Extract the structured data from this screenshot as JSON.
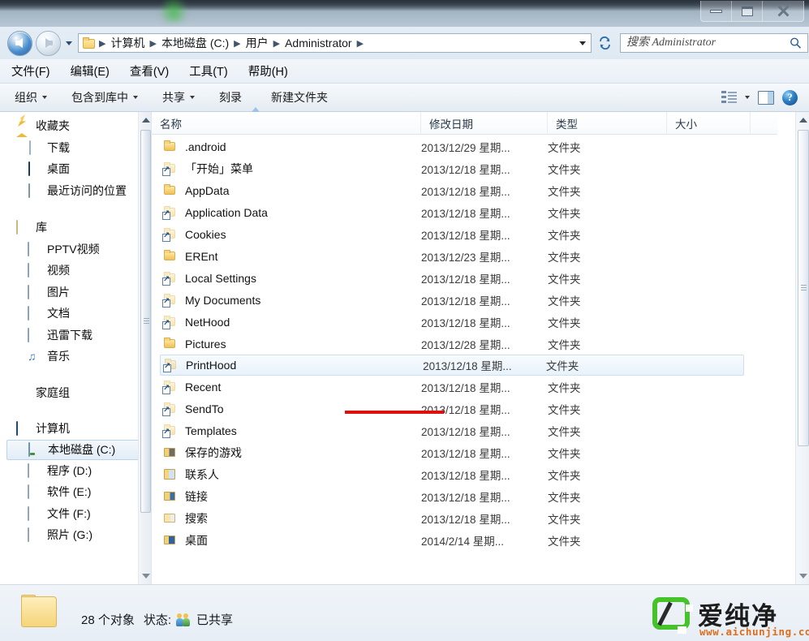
{
  "window": {
    "controls": {
      "minimize": "minimize-button",
      "maximize": "maximize-button",
      "close": "close-button"
    }
  },
  "address": {
    "back_label": "后退",
    "forward_label": "前进",
    "history_label": "最近浏览的位置",
    "refresh_label": "刷新",
    "breadcrumbs": [
      "计算机",
      "本地磁盘 (C:)",
      "用户",
      "Administrator"
    ],
    "separator": "▶"
  },
  "search": {
    "placeholder": "搜索 Administrator",
    "value": ""
  },
  "menu": {
    "items": [
      {
        "label": "文件(F)",
        "name": "menu-file"
      },
      {
        "label": "编辑(E)",
        "name": "menu-edit"
      },
      {
        "label": "查看(V)",
        "name": "menu-view"
      },
      {
        "label": "工具(T)",
        "name": "menu-tools"
      },
      {
        "label": "帮助(H)",
        "name": "menu-help"
      }
    ]
  },
  "toolbar": {
    "items": [
      {
        "label": "组织",
        "has_caret": true
      },
      {
        "label": "包含到库中",
        "has_caret": true
      },
      {
        "label": "共享",
        "has_caret": true
      },
      {
        "label": "刻录",
        "has_caret": false
      },
      {
        "label": "新建文件夹",
        "has_caret": false
      }
    ],
    "view_label": "更改您的视图",
    "preview_label": "显示预览窗格",
    "help_label": "获取帮助",
    "help_glyph": "?"
  },
  "sidebar": {
    "groups": [
      {
        "title": "收藏夹",
        "icon": "star-icon",
        "items": [
          {
            "label": "下载",
            "icon": "download-page-icon"
          },
          {
            "label": "桌面",
            "icon": "desktop-icon"
          },
          {
            "label": "最近访问的位置",
            "icon": "recent-places-icon"
          }
        ]
      },
      {
        "title": "库",
        "icon": "library-icon",
        "items": [
          {
            "label": "PPTV视频",
            "icon": "library-item-icon"
          },
          {
            "label": "视频",
            "icon": "library-item-icon"
          },
          {
            "label": "图片",
            "icon": "library-item-icon"
          },
          {
            "label": "文档",
            "icon": "library-item-icon"
          },
          {
            "label": "迅雷下载",
            "icon": "library-item-icon"
          },
          {
            "label": "音乐",
            "icon": "music-note-icon"
          }
        ]
      },
      {
        "title": "家庭组",
        "icon": "homegroup-icon",
        "items": []
      },
      {
        "title": "计算机",
        "icon": "computer-icon",
        "items": [
          {
            "label": "本地磁盘 (C:)",
            "icon": "drive-c-icon",
            "selected": true
          },
          {
            "label": "程序 (D:)",
            "icon": "drive-icon"
          },
          {
            "label": "软件 (E:)",
            "icon": "drive-icon"
          },
          {
            "label": "文件 (F:)",
            "icon": "drive-icon"
          },
          {
            "label": "照片 (G:)",
            "icon": "drive-icon"
          }
        ]
      }
    ]
  },
  "filelist": {
    "columns": [
      {
        "label": "名称",
        "name": "column-name"
      },
      {
        "label": "修改日期",
        "name": "column-date-modified"
      },
      {
        "label": "类型",
        "name": "column-type"
      },
      {
        "label": "大小",
        "name": "column-size"
      }
    ],
    "sorted_by": "名称",
    "rows": [
      {
        "name": ".android",
        "date": "2013/12/29 星期...",
        "type": "文件夹",
        "size": "",
        "icon": "folder-icon"
      },
      {
        "name": "「开始」菜单",
        "date": "2013/12/18 星期...",
        "type": "文件夹",
        "size": "",
        "icon": "folder-shortcut-icon"
      },
      {
        "name": "AppData",
        "date": "2013/12/18 星期...",
        "type": "文件夹",
        "size": "",
        "icon": "folder-icon"
      },
      {
        "name": "Application Data",
        "date": "2013/12/18 星期...",
        "type": "文件夹",
        "size": "",
        "icon": "folder-shortcut-icon"
      },
      {
        "name": "Cookies",
        "date": "2013/12/18 星期...",
        "type": "文件夹",
        "size": "",
        "icon": "folder-shortcut-icon"
      },
      {
        "name": "EREnt",
        "date": "2013/12/23 星期...",
        "type": "文件夹",
        "size": "",
        "icon": "folder-icon"
      },
      {
        "name": "Local Settings",
        "date": "2013/12/18 星期...",
        "type": "文件夹",
        "size": "",
        "icon": "folder-shortcut-icon",
        "annotated": true
      },
      {
        "name": "My Documents",
        "date": "2013/12/18 星期...",
        "type": "文件夹",
        "size": "",
        "icon": "folder-shortcut-icon"
      },
      {
        "name": "NetHood",
        "date": "2013/12/18 星期...",
        "type": "文件夹",
        "size": "",
        "icon": "folder-shortcut-icon"
      },
      {
        "name": "Pictures",
        "date": "2013/12/28 星期...",
        "type": "文件夹",
        "size": "",
        "icon": "folder-icon"
      },
      {
        "name": "PrintHood",
        "date": "2013/12/18 星期...",
        "type": "文件夹",
        "size": "",
        "icon": "folder-shortcut-icon",
        "hovered": true
      },
      {
        "name": "Recent",
        "date": "2013/12/18 星期...",
        "type": "文件夹",
        "size": "",
        "icon": "folder-shortcut-icon"
      },
      {
        "name": "SendTo",
        "date": "2013/12/18 星期...",
        "type": "文件夹",
        "size": "",
        "icon": "folder-shortcut-icon"
      },
      {
        "name": "Templates",
        "date": "2013/12/18 星期...",
        "type": "文件夹",
        "size": "",
        "icon": "folder-shortcut-icon"
      },
      {
        "name": "保存的游戏",
        "date": "2013/12/18 星期...",
        "type": "文件夹",
        "size": "",
        "icon": "saved-games-folder-icon"
      },
      {
        "name": "联系人",
        "date": "2013/12/18 星期...",
        "type": "文件夹",
        "size": "",
        "icon": "contacts-folder-icon"
      },
      {
        "name": "链接",
        "date": "2013/12/18 星期...",
        "type": "文件夹",
        "size": "",
        "icon": "links-folder-icon"
      },
      {
        "name": "搜索",
        "date": "2013/12/18 星期...",
        "type": "文件夹",
        "size": "",
        "icon": "searches-folder-icon"
      },
      {
        "name": "桌面",
        "date": "2014/2/14 星期...",
        "type": "文件夹",
        "size": "",
        "icon": "desktop-folder-icon"
      }
    ]
  },
  "statusbar": {
    "count_text": "28 个对象",
    "state_label": "状态:",
    "share_state": "已共享",
    "share_icon": "shared-users-icon"
  },
  "watermark": {
    "brand": "爱纯净",
    "url": "www.aichunjing.com",
    "accent": "#46c22a",
    "url_color": "#e06d1a"
  }
}
